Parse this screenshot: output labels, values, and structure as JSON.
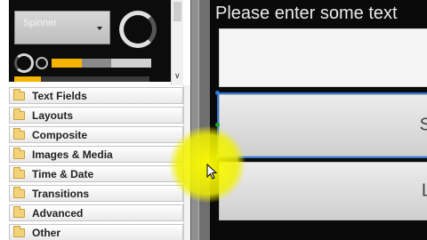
{
  "palette": {
    "preview": {
      "spinner_label": "Spinner",
      "progress_primary": 0.3,
      "progress_secondary": 0.6,
      "progress_bottom": 0.2
    },
    "categories": [
      {
        "label": "Text Fields",
        "icon": "folder-icon"
      },
      {
        "label": "Layouts",
        "icon": "folder-icon"
      },
      {
        "label": "Composite",
        "icon": "folder-icon"
      },
      {
        "label": "Images & Media",
        "icon": "folder-icon"
      },
      {
        "label": "Time & Date",
        "icon": "folder-icon"
      },
      {
        "label": "Transitions",
        "icon": "folder-icon"
      },
      {
        "label": "Advanced",
        "icon": "folder-icon"
      },
      {
        "label": "Other",
        "icon": "folder-icon"
      }
    ]
  },
  "canvas": {
    "prompt_text": "Please enter some text",
    "text_field_value": "",
    "button_1_label": "S",
    "button_2_label": "L"
  },
  "colors": {
    "selection_blue": "#2f79d6",
    "handle_green": "#22a22a",
    "accent_yellow": "#f5b400",
    "cursor_highlight": "#f0f000"
  }
}
